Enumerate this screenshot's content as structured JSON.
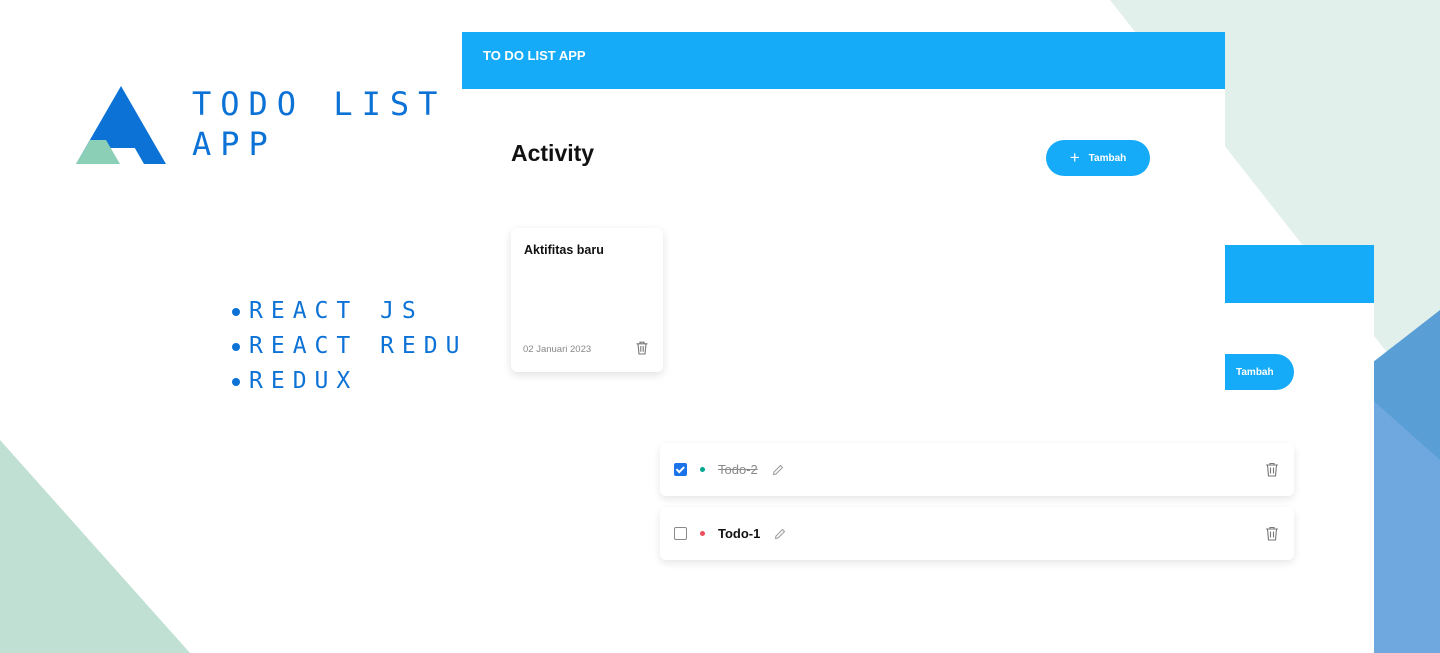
{
  "brand": {
    "title": "TODO LIST APP",
    "logo_icon": "triangle-logo-icon",
    "colors": {
      "primary": "#0c72d6",
      "accent": "#8ccfb7"
    }
  },
  "techs": [
    "REACT JS",
    "REACT REDUX",
    "REDUX"
  ],
  "activity_screen": {
    "header_title": "TO DO LIST APP",
    "page_title": "Activity",
    "add_button_label": "Tambah",
    "add_icon": "plus-icon",
    "cards": [
      {
        "title": "Aktifitas baru",
        "date": "02 Januari 2023",
        "delete_icon": "trash-icon"
      }
    ]
  },
  "detail_screen": {
    "add_button_label": "Tambah",
    "todos": [
      {
        "title": "Todo-2",
        "checked": true,
        "priority_color": "#00a790"
      },
      {
        "title": "Todo-1",
        "checked": false,
        "priority_color": "#ed4c5c"
      }
    ]
  },
  "colors": {
    "header": "#16abf8",
    "bg_mint": "#e2f0eb",
    "bg_blue": "#5a9fd8"
  }
}
